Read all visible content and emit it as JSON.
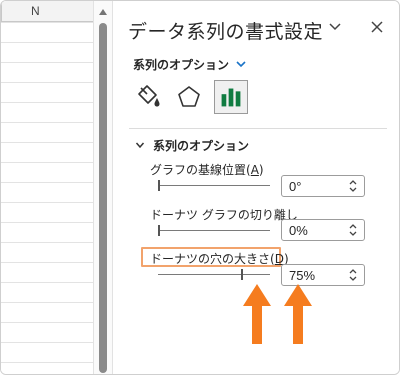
{
  "sheet": {
    "column_label": "N"
  },
  "pane": {
    "title": "データ系列の書式設定",
    "options_menu_label": "系列のオプション",
    "tabs": [
      {
        "name": "fill-line",
        "icon": "paint-bucket-icon"
      },
      {
        "name": "effects",
        "icon": "pentagon-icon"
      },
      {
        "name": "series-options",
        "icon": "bar-chart-icon",
        "selected": true
      }
    ],
    "section_title": "系列のオプション",
    "options": [
      {
        "label": "グラフの基線位置(A)",
        "value": "0°",
        "level": 0
      },
      {
        "label": "ドーナツ グラフの切り離し",
        "value": "0%",
        "level": 0
      },
      {
        "label": "ドーナツの穴の大きさ(D)",
        "value": "75%",
        "level": 0.75
      }
    ]
  },
  "colors": {
    "accent": "#107c41",
    "highlight": "#f2a36c",
    "arrow": "#f57c1f",
    "chevron_blue": "#1a73c7"
  }
}
